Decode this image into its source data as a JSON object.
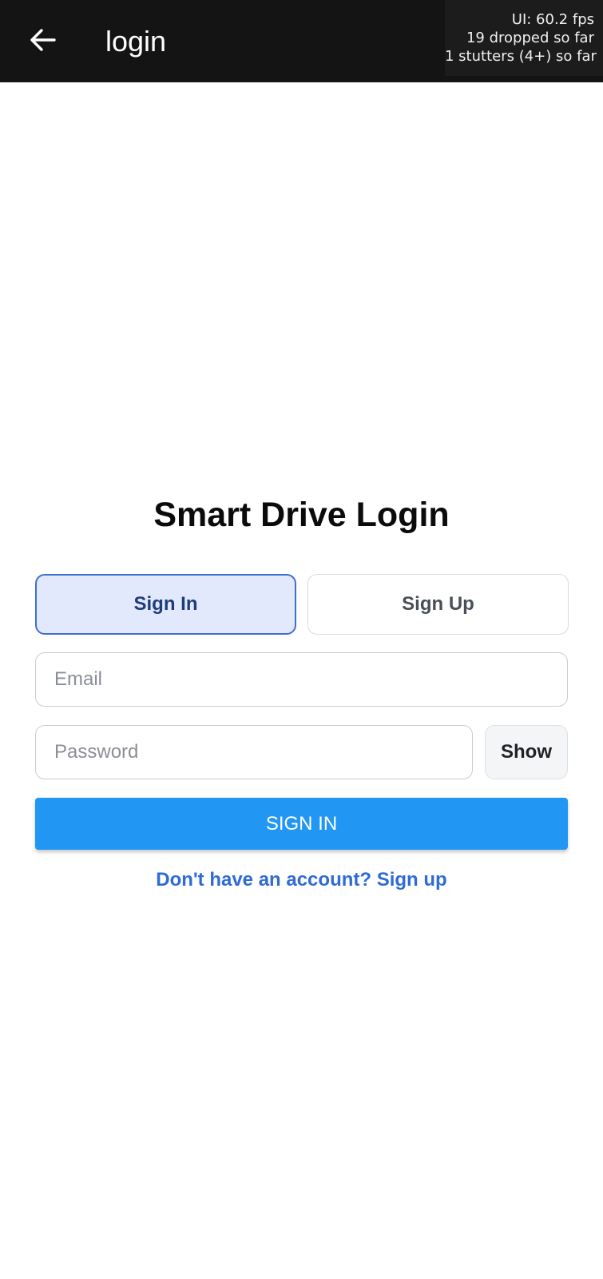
{
  "app_bar": {
    "title": "login",
    "back_icon": "arrow-left-icon"
  },
  "perf_overlay": {
    "fps": "UI: 60.2 fps",
    "dropped": "19 dropped so far",
    "stutters": "1 stutters (4+) so far"
  },
  "auth": {
    "title": "Smart Drive Login",
    "tabs": [
      {
        "label": "Sign In",
        "selected": true
      },
      {
        "label": "Sign Up",
        "selected": false
      }
    ],
    "email": {
      "placeholder": "Email",
      "value": ""
    },
    "password": {
      "placeholder": "Password",
      "value": ""
    },
    "show_label": "Show",
    "submit_label": "SIGN IN",
    "signup_link": "Don't have an account? Sign up"
  },
  "colors": {
    "app_bar": "#141414",
    "primary": "#2196f3",
    "link": "#2f6bd6",
    "tab_selected_bg": "#e3e9fd",
    "tab_selected_border": "#3d6fd0"
  }
}
